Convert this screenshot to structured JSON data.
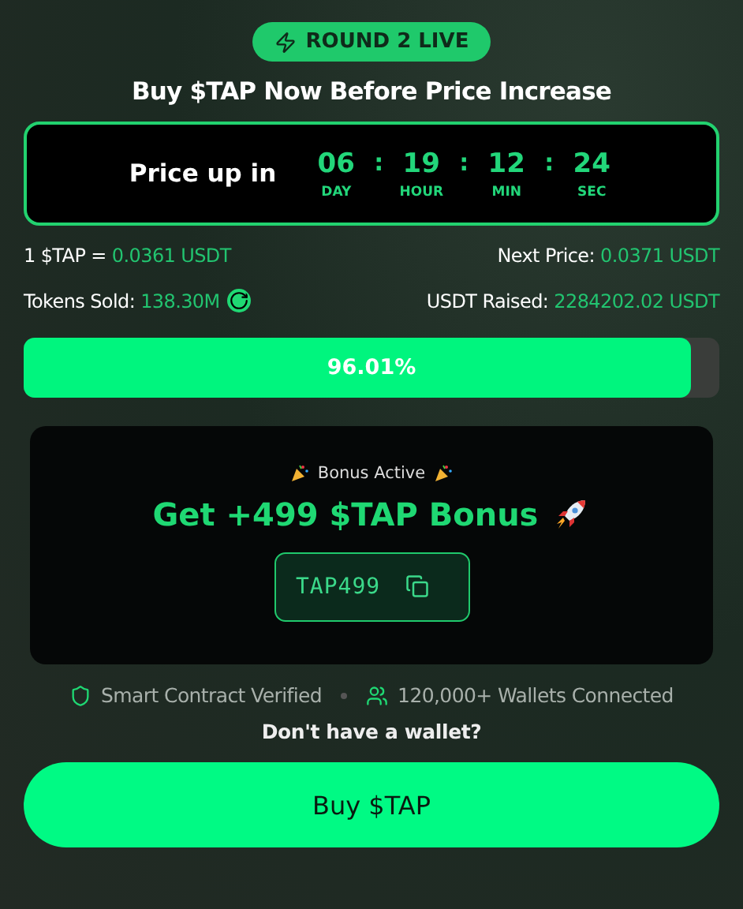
{
  "badge": {
    "label": "ROUND 2 LIVE"
  },
  "headline": "Buy $TAP Now Before Price Increase",
  "countdown": {
    "label": "Price up in",
    "units": [
      {
        "value": "06",
        "unit": "DAY"
      },
      {
        "value": "19",
        "unit": "HOUR"
      },
      {
        "value": "12",
        "unit": "MIN"
      },
      {
        "value": "24",
        "unit": "SEC"
      }
    ],
    "separator": ":"
  },
  "stats": [
    {
      "kind": "plain",
      "label": "1 $TAP = ",
      "value": "0.0361 USDT"
    },
    {
      "kind": "plain",
      "label": "Next Price: ",
      "value": "0.0371 USDT"
    },
    {
      "kind": "refresh",
      "label": "Tokens Sold: ",
      "value": "138.30M"
    },
    {
      "kind": "plain",
      "label": "USDT Raised: ",
      "value": "2284202.02 USDT"
    }
  ],
  "progress": {
    "level": 0.9601,
    "reading": "96.01%"
  },
  "bonus": {
    "status": "Bonus Active",
    "headline": "Get +499 $TAP Bonus",
    "code": "TAP499"
  },
  "trust": [
    {
      "kind": "shield",
      "label": "Smart Contract Verified"
    },
    {
      "kind": "users",
      "label": "120,000+ Wallets Connected"
    }
  ],
  "wallet_prompt": "Don't have a wallet?",
  "buy_button": "Buy $TAP"
}
